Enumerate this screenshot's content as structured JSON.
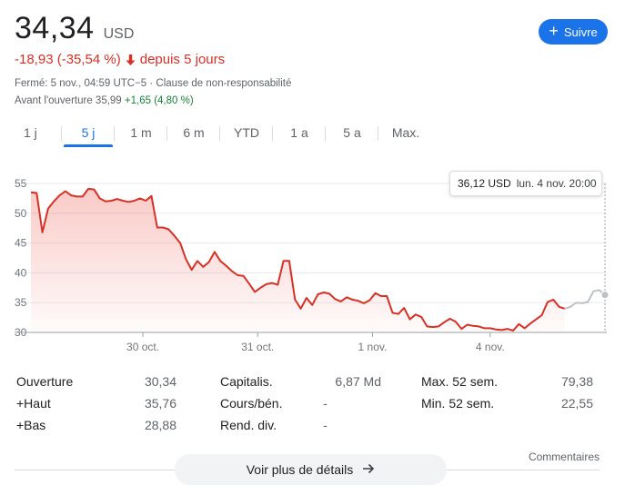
{
  "header": {
    "price": "34,34",
    "currency": "USD",
    "follow_label": "Suivre",
    "change": "-18,93 (-35,54 %)",
    "period": "depuis 5 jours",
    "status_line": "Fermé: 5 nov., 04:59 UTC−5 · Clause de non-responsabilité",
    "premarket_label": "Avant l'ouverture 35,99",
    "premarket_change": "+1,65 (4,80 %)"
  },
  "tabs": [
    {
      "label": "1 j",
      "active": false
    },
    {
      "label": "5 j",
      "active": true
    },
    {
      "label": "1 m",
      "active": false
    },
    {
      "label": "6 m",
      "active": false
    },
    {
      "label": "YTD",
      "active": false
    },
    {
      "label": "1 a",
      "active": false
    },
    {
      "label": "5 a",
      "active": false
    },
    {
      "label": "Max.",
      "active": false
    }
  ],
  "tooltip": {
    "value": "36,12 USD",
    "time": "lun. 4 nov. 20:00"
  },
  "colors": {
    "accent": "#1a73e8",
    "down": "#d93025",
    "up": "#188038",
    "extended": "#bdc1c6"
  },
  "chart_data": {
    "type": "line",
    "ylim": [
      30,
      56
    ],
    "yticks": [
      "55",
      "50",
      "45",
      "40",
      "35",
      "30"
    ],
    "xticks": [
      "30 oct.",
      "31 oct.",
      "1 nov.",
      "4 nov."
    ],
    "x_range": [
      0,
      100
    ],
    "xtick_positions": [
      19.5,
      39.5,
      59.5,
      80
    ],
    "series": [
      {
        "points": [
          [
            0,
            53.5
          ],
          [
            1,
            53.4
          ],
          [
            2,
            46.8
          ],
          [
            3,
            50.8
          ],
          [
            4,
            52.0
          ],
          [
            5,
            53.0
          ],
          [
            6,
            53.7
          ],
          [
            7,
            53.0
          ],
          [
            8,
            52.8
          ],
          [
            9,
            52.8
          ],
          [
            10,
            54.1
          ],
          [
            11,
            54.0
          ],
          [
            12,
            52.5
          ],
          [
            13,
            52.0
          ],
          [
            14,
            52.1
          ],
          [
            15,
            52.4
          ],
          [
            16,
            52.1
          ],
          [
            17,
            51.9
          ],
          [
            18,
            52.1
          ],
          [
            19,
            52.5
          ],
          [
            20,
            52.1
          ],
          [
            21,
            52.9
          ],
          [
            22,
            47.6
          ],
          [
            23,
            47.6
          ],
          [
            24,
            47.3
          ],
          [
            25,
            46.2
          ],
          [
            26,
            45.0
          ],
          [
            27,
            42.3
          ],
          [
            28,
            40.5
          ],
          [
            29,
            42.0
          ],
          [
            30,
            41.0
          ],
          [
            31,
            41.8
          ],
          [
            32,
            43.5
          ],
          [
            33,
            42.0
          ],
          [
            34,
            41.2
          ],
          [
            35,
            40.3
          ],
          [
            36,
            39.6
          ],
          [
            37,
            39.5
          ],
          [
            38,
            38.2
          ],
          [
            39,
            36.8
          ],
          [
            40,
            37.5
          ],
          [
            41,
            38.1
          ],
          [
            42,
            38.3
          ],
          [
            43,
            38.0
          ],
          [
            44,
            42.0
          ],
          [
            45,
            42.0
          ],
          [
            46,
            35.5
          ],
          [
            47,
            34.0
          ],
          [
            48,
            35.8
          ],
          [
            49,
            34.6
          ],
          [
            50,
            36.4
          ],
          [
            51,
            36.7
          ],
          [
            52,
            36.5
          ],
          [
            53,
            35.6
          ],
          [
            54,
            35.2
          ],
          [
            55,
            35.9
          ],
          [
            56,
            35.5
          ],
          [
            57,
            35.3
          ],
          [
            58,
            34.9
          ],
          [
            59,
            35.4
          ],
          [
            60,
            36.6
          ],
          [
            61,
            36.1
          ],
          [
            62,
            36.1
          ],
          [
            63,
            33.3
          ],
          [
            64,
            33.1
          ],
          [
            65,
            34.1
          ],
          [
            66,
            32.2
          ],
          [
            67,
            33.0
          ],
          [
            68,
            32.6
          ],
          [
            69,
            31.0
          ],
          [
            70,
            30.9
          ],
          [
            71,
            31.0
          ],
          [
            72,
            31.7
          ],
          [
            73,
            32.3
          ],
          [
            74,
            31.8
          ],
          [
            75,
            30.6
          ],
          [
            76,
            31.3
          ],
          [
            77,
            31.1
          ],
          [
            78,
            31.0
          ],
          [
            79,
            30.7
          ],
          [
            80,
            30.7
          ],
          [
            81,
            30.5
          ],
          [
            82,
            30.4
          ],
          [
            83,
            30.6
          ],
          [
            84,
            30.3
          ],
          [
            85,
            31.4
          ],
          [
            86,
            30.7
          ],
          [
            87,
            31.5
          ],
          [
            88,
            32.2
          ],
          [
            89,
            32.9
          ],
          [
            90,
            35.1
          ],
          [
            91,
            35.5
          ],
          [
            92,
            34.3
          ],
          [
            93,
            34.0
          ]
        ]
      },
      {
        "extended": true,
        "points": [
          [
            93,
            34.0
          ],
          [
            94,
            34.3
          ],
          [
            95,
            35.0
          ],
          [
            96,
            34.9
          ],
          [
            97,
            35.1
          ],
          [
            98,
            36.9
          ],
          [
            99,
            37.1
          ],
          [
            100,
            36.3
          ]
        ]
      }
    ]
  },
  "stats": [
    {
      "label": "Ouverture",
      "value": "30,34"
    },
    {
      "label": "+Haut",
      "value": "35,76"
    },
    {
      "label": "+Bas",
      "value": "28,88"
    },
    {
      "label": "Capitalis.",
      "value": "6,87 Md"
    },
    {
      "label": "Cours/bén.",
      "value": "-"
    },
    {
      "label": "Rend. div.",
      "value": "-"
    },
    {
      "label": "Max. 52 sem.",
      "value": "79,38"
    },
    {
      "label": "Min. 52 sem.",
      "value": "22,55"
    }
  ],
  "footer": {
    "comments_label": "Commentaires",
    "details_label": "Voir plus de détails"
  }
}
